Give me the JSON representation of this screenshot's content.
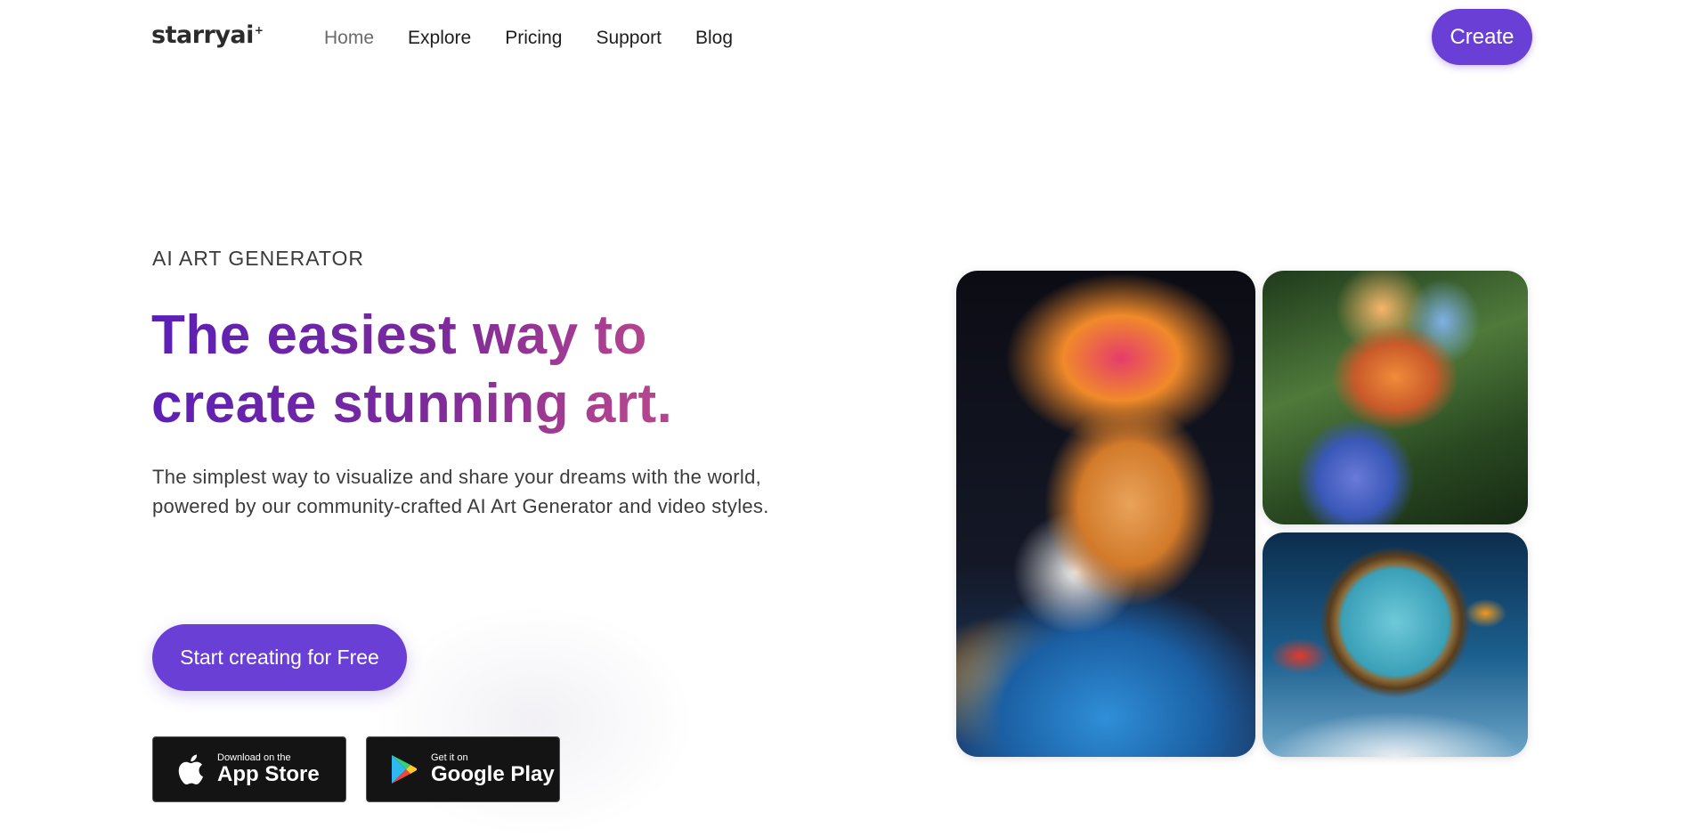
{
  "brand": {
    "logo": "starryai",
    "logo_star": "+"
  },
  "nav": {
    "items": [
      {
        "label": "Home",
        "active": true
      },
      {
        "label": "Explore"
      },
      {
        "label": "Pricing"
      },
      {
        "label": "Support"
      },
      {
        "label": "Blog"
      }
    ],
    "create_label": "Create"
  },
  "hero": {
    "eyebrow": "AI ART GENERATOR",
    "headline": "The easiest way to create stunning art.",
    "subheadline": "The simplest way to visualize and share your dreams with the world, powered by our community-crafted AI Art Generator and video styles.",
    "cta_label": "Start creating for Free"
  },
  "stores": {
    "appstore": {
      "small": "Download on the",
      "big": "App Store",
      "icon": "apple-icon"
    },
    "googleplay": {
      "small": "Get it on",
      "big": "Google Play",
      "icon": "google-play-icon"
    }
  },
  "gallery": {
    "images": [
      "tiger-artwork",
      "bird-artwork",
      "melting-clock-artwork"
    ]
  },
  "colors": {
    "accent": "#6a3fd6",
    "headline_gradient": [
      "#5a1fb8",
      "#b4448e"
    ]
  }
}
